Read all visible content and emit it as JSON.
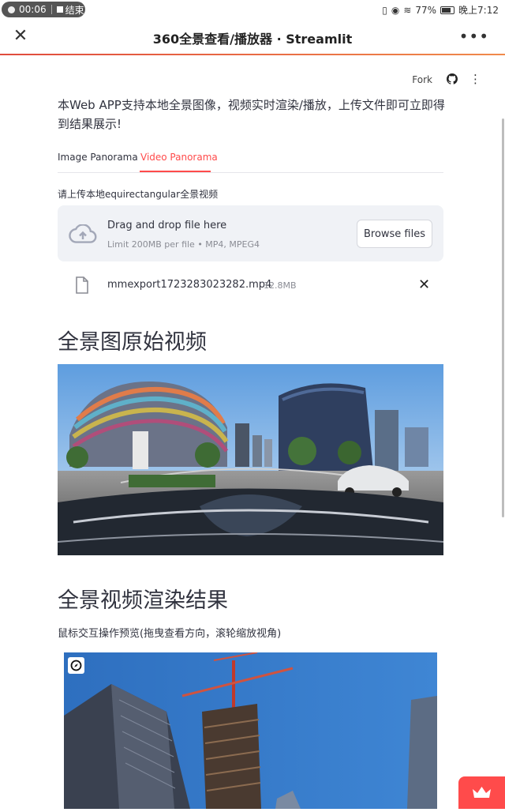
{
  "status_bar": {
    "record_time": "00:06",
    "record_stop_label": "结束",
    "battery": "77%",
    "clock": "晚上7:12"
  },
  "app_bar": {
    "title": "360全景查看/播放器 · Streamlit"
  },
  "toolbar": {
    "fork_label": "Fork"
  },
  "intro_text": "本Web APP支持本地全景图像，视频实时渲染/播放，上传文件即可立即得到结果展示!",
  "tabs": [
    {
      "label": "Image Panorama",
      "active": false
    },
    {
      "label": "Video Panorama",
      "active": true
    }
  ],
  "uploader": {
    "label": "请上传本地equirectangular全景视频",
    "drop_title": "Drag and drop file here",
    "limit_text": "Limit 200MB per file • MP4, MPEG4",
    "browse_label": "Browse files",
    "file_name": "mmexport1723283023282.mp4",
    "file_size": "12.8MB"
  },
  "section1_title": "全景图原始视频",
  "section2_title": "全景视频渲染结果",
  "section2_caption": "鼠标交互操作预览(拖曳查看方向，滚轮缩放视角)",
  "colors": {
    "accent": "#ff4b4b",
    "text": "#31333f",
    "dropzone_bg": "#f0f2f6"
  }
}
